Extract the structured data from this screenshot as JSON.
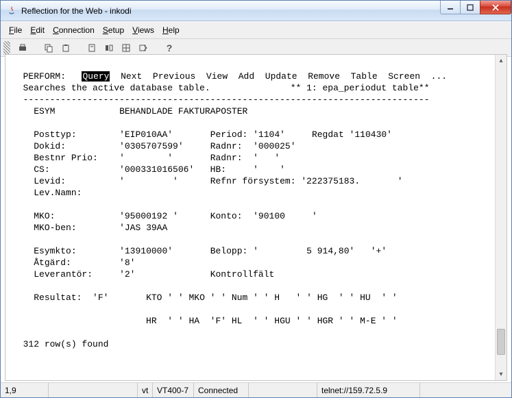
{
  "window": {
    "title": "Reflection for the Web - inkodi"
  },
  "menu": {
    "file": "File",
    "edit": "Edit",
    "connection": "Connection",
    "setup": "Setup",
    "views": "Views",
    "help": "Help"
  },
  "terminal": {
    "perform_label": "PERFORM:",
    "actions": {
      "query": "Query",
      "next": "Next",
      "previous": "Previous",
      "view": "View",
      "add": "Add",
      "update": "Update",
      "remove": "Remove",
      "table": "Table",
      "screen": "Screen",
      "more": "..."
    },
    "subtitle_left": "Searches the active database table.",
    "subtitle_right": "** 1: epa_periodut table**",
    "hr": "----------------------------------------------------------------------------",
    "header_left": "ESYM",
    "header_right": "BEHANDLADE FAKTURAPOSTER",
    "fields": {
      "posttyp_l": "Posttyp:",
      "posttyp_v": "'EIP010AA'",
      "period_l": "Period:",
      "period_v": "'1104'",
      "regdat_l": "Regdat",
      "regdat_v": "'110430'",
      "dokid_l": "Dokid:",
      "dokid_v": "'0305707599'",
      "radnr1_l": "Radnr:",
      "radnr1_v": "'000025'",
      "bestnr_l": "Bestnr Prio:",
      "bestnr_v": "'        '",
      "radnr2_l": "Radnr:",
      "radnr2_v": "'   '",
      "cs_l": "CS:",
      "cs_v": "'000331016506'",
      "hb_l": "HB:",
      "hb_v": "'    '",
      "levid_l": "Levid:",
      "levid_v": "'         '",
      "refnr_l": "Refnr försystem:",
      "refnr_v": "'222375183.       '",
      "levnamn_l": "Lev.Namn:",
      "mko_l": "MKO:",
      "mko_v": "'95000192 '",
      "konto_l": "Konto:",
      "konto_v": "'90100     '",
      "mkoben_l": "MKO-ben:",
      "mkoben_v": "'JAS 39AA",
      "esymkto_l": "Esymkto:",
      "esymkto_v": "'13910000'",
      "belopp_l": "Belopp:",
      "belopp_v": "'         5 914,80'   '+'",
      "atgard_l": "Åtgärd:",
      "atgard_v": "'8'",
      "leverantor_l": "Leverantör:",
      "leverantor_v": "'2'",
      "kontrollfalt_l": "Kontrollfält",
      "resultat_l": "Resultat:",
      "resultat_v": "'F'",
      "res_line1": "KTO ' ' MKO ' ' Num ' ' H   ' ' HG  ' ' HU  ' '",
      "res_line2": "HR  ' ' HA  'F' HL  ' ' HGU ' ' HGR ' ' M-E ' '"
    },
    "footer": "312 row(s) found"
  },
  "status": {
    "pos": "1,9",
    "vt": "vt",
    "emul": "VT400-7",
    "conn": "Connected",
    "url": "telnet://159.72.5.9"
  }
}
